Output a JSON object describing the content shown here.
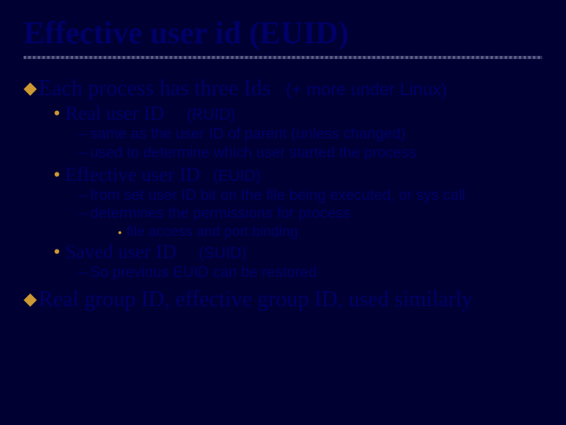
{
  "title": "Effective user id (EUID)",
  "b1": {
    "text": "Each process has three Ids",
    "note": "(+ more under Linux)"
  },
  "ruid": {
    "label": "Real user ID",
    "tag": "(RUID)",
    "d1": "same as the user ID of parent (unless changed)",
    "d2": "used to determine which user started the process"
  },
  "euid": {
    "label": "Effective user ID",
    "tag": "(EUID)",
    "d1": "from set user ID bit on the file being executed, or sys call",
    "d2": "determines the permissions for process",
    "d2a": "file access and port binding"
  },
  "suid": {
    "label": "Saved user ID",
    "tag": "(SUID)",
    "d1": "So previous EUID can be restored"
  },
  "b2": "Real group ID, effective group ID, used similarly"
}
